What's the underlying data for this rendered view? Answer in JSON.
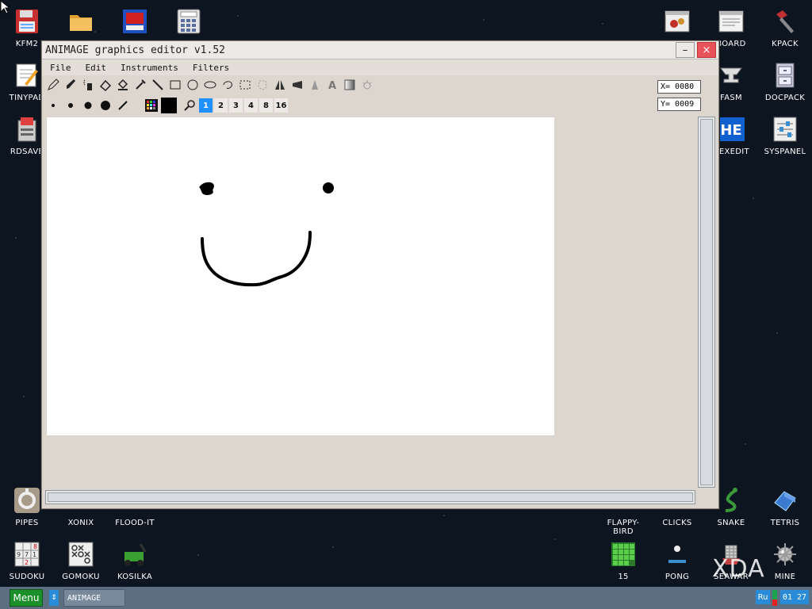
{
  "desktop_icons": [
    {
      "id": "kfm2",
      "label": "KFM2"
    },
    {
      "id": "folder",
      "label": ""
    },
    {
      "id": "screen",
      "label": ""
    },
    {
      "id": "calc",
      "label": ""
    },
    {
      "id": "tinypad",
      "label": "TINYPAD"
    },
    {
      "id": "rdsave",
      "label": "RDSAVE"
    },
    {
      "id": "bugs",
      "label": ""
    },
    {
      "id": "board",
      "label": "BOARD"
    },
    {
      "id": "kpack",
      "label": "KPACK"
    },
    {
      "id": "fasm",
      "label": "FASM"
    },
    {
      "id": "docpack",
      "label": "DOCPACK"
    },
    {
      "id": "hexedit",
      "label": "HEXEDIT"
    },
    {
      "id": "syspanel",
      "label": "SYSPANEL"
    },
    {
      "id": "pipes",
      "label": "PIPES"
    },
    {
      "id": "xonix",
      "label": "XONIX"
    },
    {
      "id": "floodit",
      "label": "FLOOD-IT"
    },
    {
      "id": "flappy",
      "label": "FLAPPY-BIRD"
    },
    {
      "id": "clicks",
      "label": "CLICKS"
    },
    {
      "id": "snake",
      "label": "SNAKE"
    },
    {
      "id": "tetris",
      "label": "TETRIS"
    },
    {
      "id": "sudoku",
      "label": "SUDOKU"
    },
    {
      "id": "gomoku",
      "label": "GOMOKU"
    },
    {
      "id": "kosilka",
      "label": "KOSILKA"
    },
    {
      "id": "fifteen",
      "label": "15"
    },
    {
      "id": "pong",
      "label": "PONG"
    },
    {
      "id": "seawar",
      "label": "SEAWAR"
    },
    {
      "id": "mine",
      "label": "MINE"
    }
  ],
  "window": {
    "title": "ANIMAGE graphics editor v1.52",
    "minimize": "–",
    "close": "×",
    "menu": [
      "File",
      "Edit",
      "Instruments",
      "Filters"
    ],
    "coords": {
      "x": "X= 0080",
      "y": "Y= 0009"
    },
    "brush_sizes": [
      "1",
      "2",
      "3",
      "4",
      "8",
      "16"
    ],
    "active_size": "1"
  },
  "colors": {
    "accent": "#1e90ff",
    "menu_green": "#1a8f2a",
    "taskbar": "#5b6e82",
    "close": "#e8535a"
  },
  "taskbar": {
    "menu_label": "Menu",
    "switch_icon": "⇕",
    "task": "ANIMAGE",
    "language": "Ru",
    "clock": "01 27"
  },
  "watermark": "XDA"
}
